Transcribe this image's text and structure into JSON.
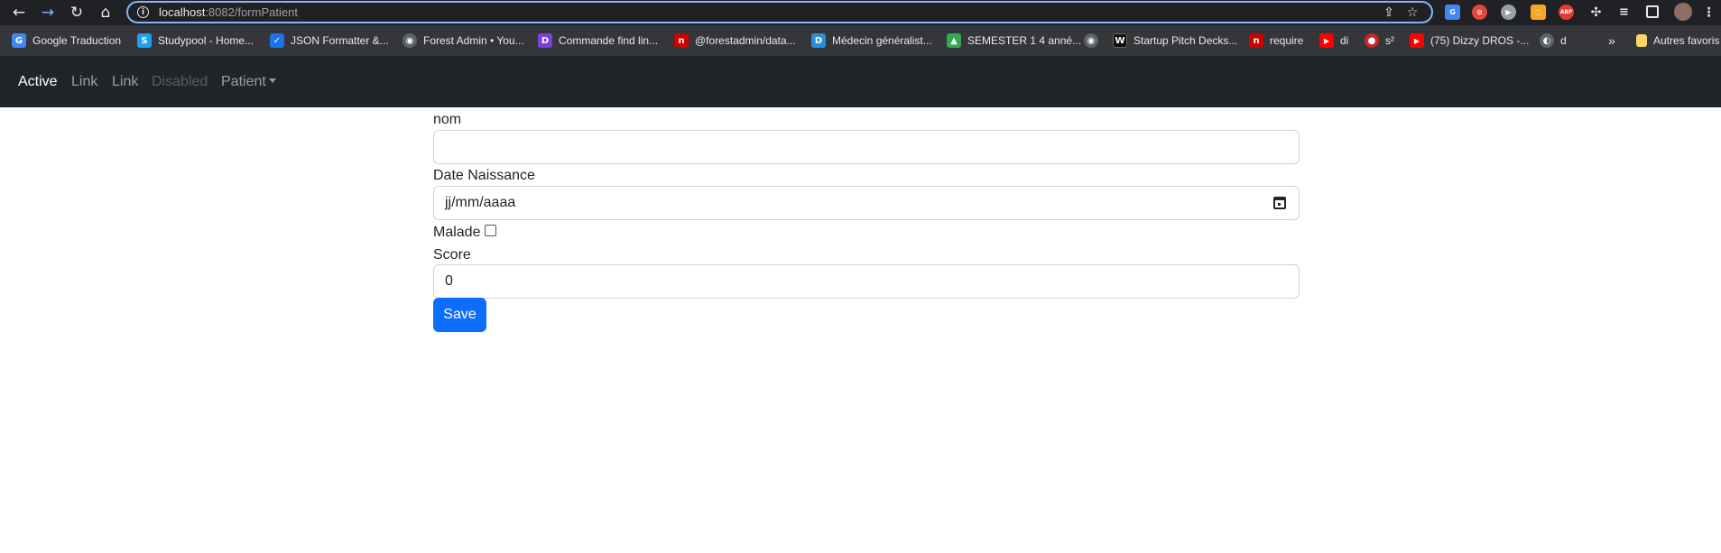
{
  "browser": {
    "url_host": "localhost",
    "url_rest": ":8082/formPatient",
    "icons": [
      "back-icon",
      "forward-icon",
      "reload-icon",
      "home-icon",
      "info-icon",
      "share-icon",
      "star-icon"
    ],
    "extensions": {
      "abp_label": "ABP"
    },
    "bookmarks": [
      {
        "label": "Google Traduction",
        "icon": "G",
        "color": "#4285f4"
      },
      {
        "label": "Studypool - Home...",
        "icon": "S",
        "color": "#1da1f2"
      },
      {
        "label": "JSON Formatter &...",
        "icon": "✓",
        "color": "#1a73e8"
      },
      {
        "label": "Forest Admin • You...",
        "icon": "◉",
        "color": "#5f6368"
      },
      {
        "label": "Commande find lin...",
        "icon": "D",
        "color": "#7b3fe4"
      },
      {
        "label": "@forestadmin/data...",
        "icon": "n",
        "color": "#cb0000"
      },
      {
        "label": "Médecin généralist...",
        "icon": "D",
        "color": "#2b8fd6"
      },
      {
        "label": "SEMESTER 1 4 anné...",
        "icon": "▲",
        "color": "#34a853"
      },
      {
        "label": "",
        "icon": "◉",
        "color": "#5f6368"
      },
      {
        "label": "Startup Pitch Decks...",
        "icon": "W",
        "color": "#111111"
      },
      {
        "label": "require",
        "icon": "n",
        "color": "#cb0000"
      },
      {
        "label": "di",
        "icon": "▶",
        "color": "#ff0000"
      },
      {
        "label": "s²",
        "icon": "●",
        "color": "#c62828"
      },
      {
        "label": "(75) Dizzy DROS -...",
        "icon": "▶",
        "color": "#ff0000"
      },
      {
        "label": "d",
        "icon": "◐",
        "color": "#5f6368"
      }
    ],
    "overflow": "»",
    "other_favorites": "Autres favoris"
  },
  "navbar": {
    "items": [
      {
        "label": "Active",
        "state": "active"
      },
      {
        "label": "Link",
        "state": "normal"
      },
      {
        "label": "Link",
        "state": "normal"
      },
      {
        "label": "Disabled",
        "state": "disabled"
      },
      {
        "label": "Patient",
        "state": "dropdown"
      }
    ],
    "bg_color": "#212529"
  },
  "form": {
    "nom_label": "nom",
    "nom_value": "",
    "date_label": "Date Naissance",
    "date_placeholder": "jj/mm/aaaa",
    "malade_label": "Malade",
    "malade_checked": false,
    "score_label": "Score",
    "score_value": "0",
    "save_label": "Save",
    "accent_color": "#0d6efd"
  }
}
